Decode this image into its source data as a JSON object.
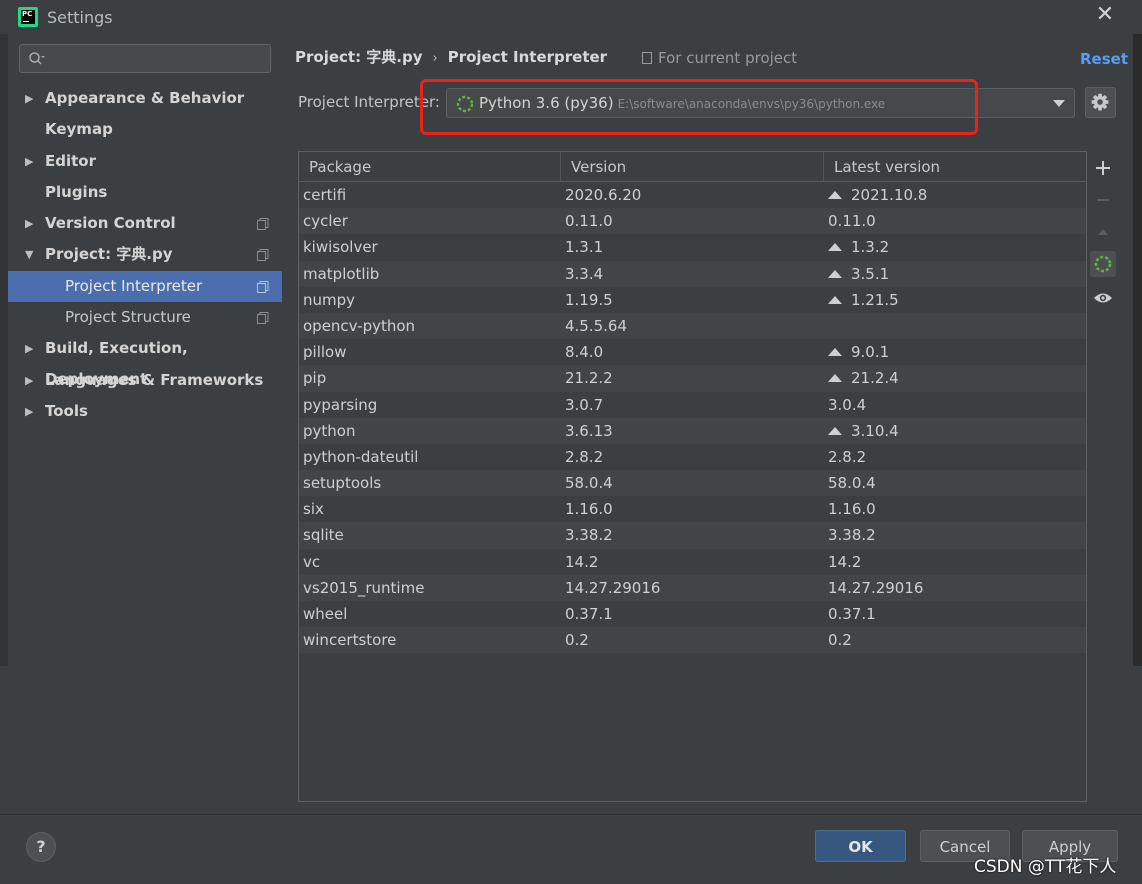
{
  "window": {
    "title": "Settings",
    "close": "✕"
  },
  "sidebar": {
    "search_placeholder": "",
    "items": [
      {
        "label": "Appearance & Behavior",
        "arrow": "▶"
      },
      {
        "label": "Keymap"
      },
      {
        "label": "Editor",
        "arrow": "▶"
      },
      {
        "label": "Plugins"
      },
      {
        "label": "Version Control",
        "arrow": "▶"
      },
      {
        "label": "Project: 字典.py",
        "arrow": "▼"
      },
      {
        "label": "Project Interpreter"
      },
      {
        "label": "Project Structure"
      },
      {
        "label": "Build, Execution, Deployment",
        "arrow": "▶"
      },
      {
        "label": "Languages & Frameworks",
        "arrow": "▶"
      },
      {
        "label": "Tools",
        "arrow": "▶"
      }
    ]
  },
  "header": {
    "breadcrumb_project": "Project: 字典.py",
    "breadcrumb_sep": "›",
    "breadcrumb_page": "Project Interpreter",
    "scope": "For current project",
    "reset": "Reset"
  },
  "interpreter": {
    "label": "Project Interpreter:",
    "name": "Python 3.6 (py36)",
    "path": "E:\\software\\anaconda\\envs\\py36\\python.exe"
  },
  "table": {
    "columns": [
      "Package",
      "Version",
      "Latest version"
    ],
    "rows": [
      {
        "package": "certifi",
        "version": "2020.6.20",
        "latest": "2021.10.8",
        "upgrade": true
      },
      {
        "package": "cycler",
        "version": "0.11.0",
        "latest": "0.11.0",
        "upgrade": false
      },
      {
        "package": "kiwisolver",
        "version": "1.3.1",
        "latest": "1.3.2",
        "upgrade": true
      },
      {
        "package": "matplotlib",
        "version": "3.3.4",
        "latest": "3.5.1",
        "upgrade": true
      },
      {
        "package": "numpy",
        "version": "1.19.5",
        "latest": "1.21.5",
        "upgrade": true
      },
      {
        "package": "opencv-python",
        "version": "4.5.5.64",
        "latest": "",
        "upgrade": false
      },
      {
        "package": "pillow",
        "version": "8.4.0",
        "latest": "9.0.1",
        "upgrade": true
      },
      {
        "package": "pip",
        "version": "21.2.2",
        "latest": "21.2.4",
        "upgrade": true
      },
      {
        "package": "pyparsing",
        "version": "3.0.7",
        "latest": "3.0.4",
        "upgrade": false
      },
      {
        "package": "python",
        "version": "3.6.13",
        "latest": "3.10.4",
        "upgrade": true
      },
      {
        "package": "python-dateutil",
        "version": "2.8.2",
        "latest": "2.8.2",
        "upgrade": false
      },
      {
        "package": "setuptools",
        "version": "58.0.4",
        "latest": "58.0.4",
        "upgrade": false
      },
      {
        "package": "six",
        "version": "1.16.0",
        "latest": "1.16.0",
        "upgrade": false
      },
      {
        "package": "sqlite",
        "version": "3.38.2",
        "latest": "3.38.2",
        "upgrade": false
      },
      {
        "package": "vc",
        "version": "14.2",
        "latest": "14.2",
        "upgrade": false
      },
      {
        "package": "vs2015_runtime",
        "version": "14.27.29016",
        "latest": "14.27.29016",
        "upgrade": false
      },
      {
        "package": "wheel",
        "version": "0.37.1",
        "latest": "0.37.1",
        "upgrade": false
      },
      {
        "package": "wincertstore",
        "version": "0.2",
        "latest": "0.2",
        "upgrade": false
      }
    ]
  },
  "footer": {
    "help": "?",
    "ok": "OK",
    "cancel": "Cancel",
    "apply": "Apply",
    "watermark": "CSDN @TT花下人"
  },
  "colors": {
    "background": "#3c3f41",
    "selection": "#4b6eaf",
    "link": "#589df6",
    "highlight_box": "#e8231b",
    "ok_button": "#365880"
  }
}
